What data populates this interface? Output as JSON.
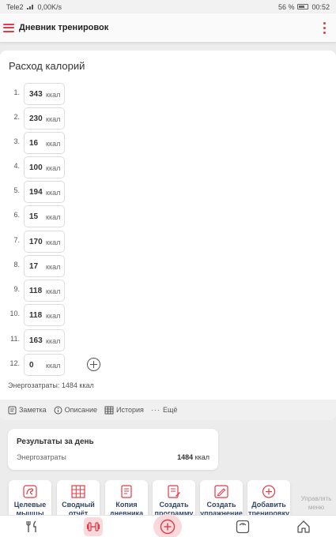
{
  "status_bar": {
    "carrier": "Tele2",
    "net_speed": "0,00K/s",
    "battery": "56 %",
    "time": "00:52"
  },
  "appbar": {
    "title": "Дневник тренировок"
  },
  "calories_card": {
    "title": "Расход калорий",
    "unit": "ккал",
    "rows": [
      {
        "num": "1.",
        "value": "343"
      },
      {
        "num": "2.",
        "value": "230"
      },
      {
        "num": "3.",
        "value": "16"
      },
      {
        "num": "4.",
        "value": "100"
      },
      {
        "num": "5.",
        "value": "194"
      },
      {
        "num": "6.",
        "value": "15"
      },
      {
        "num": "7.",
        "value": "170"
      },
      {
        "num": "8.",
        "value": "17"
      },
      {
        "num": "9.",
        "value": "118"
      },
      {
        "num": "10.",
        "value": "118"
      },
      {
        "num": "11.",
        "value": "163"
      },
      {
        "num": "12.",
        "value": "0"
      }
    ],
    "energy_total": "Энергозатраты: 1484 ккал"
  },
  "card_actions": {
    "note": "Заметка",
    "description": "Описание",
    "history": "История",
    "more": "Ещё"
  },
  "day_results": {
    "title": "Результаты за день",
    "label": "Энергозатраты",
    "value": "1484",
    "unit": "ккал"
  },
  "tiles": [
    {
      "label": "Целевые мышцы"
    },
    {
      "label": "Сводный отчёт"
    },
    {
      "label": "Копия дневника"
    },
    {
      "label": "Создать программу"
    },
    {
      "label": "Создать упражнение"
    },
    {
      "label": "Добавить тренировку"
    },
    {
      "label": "Управлять меню"
    }
  ],
  "colors": {
    "accent": "#e53945",
    "accent_soft": "#f9d9db",
    "tile_text": "#334466"
  }
}
